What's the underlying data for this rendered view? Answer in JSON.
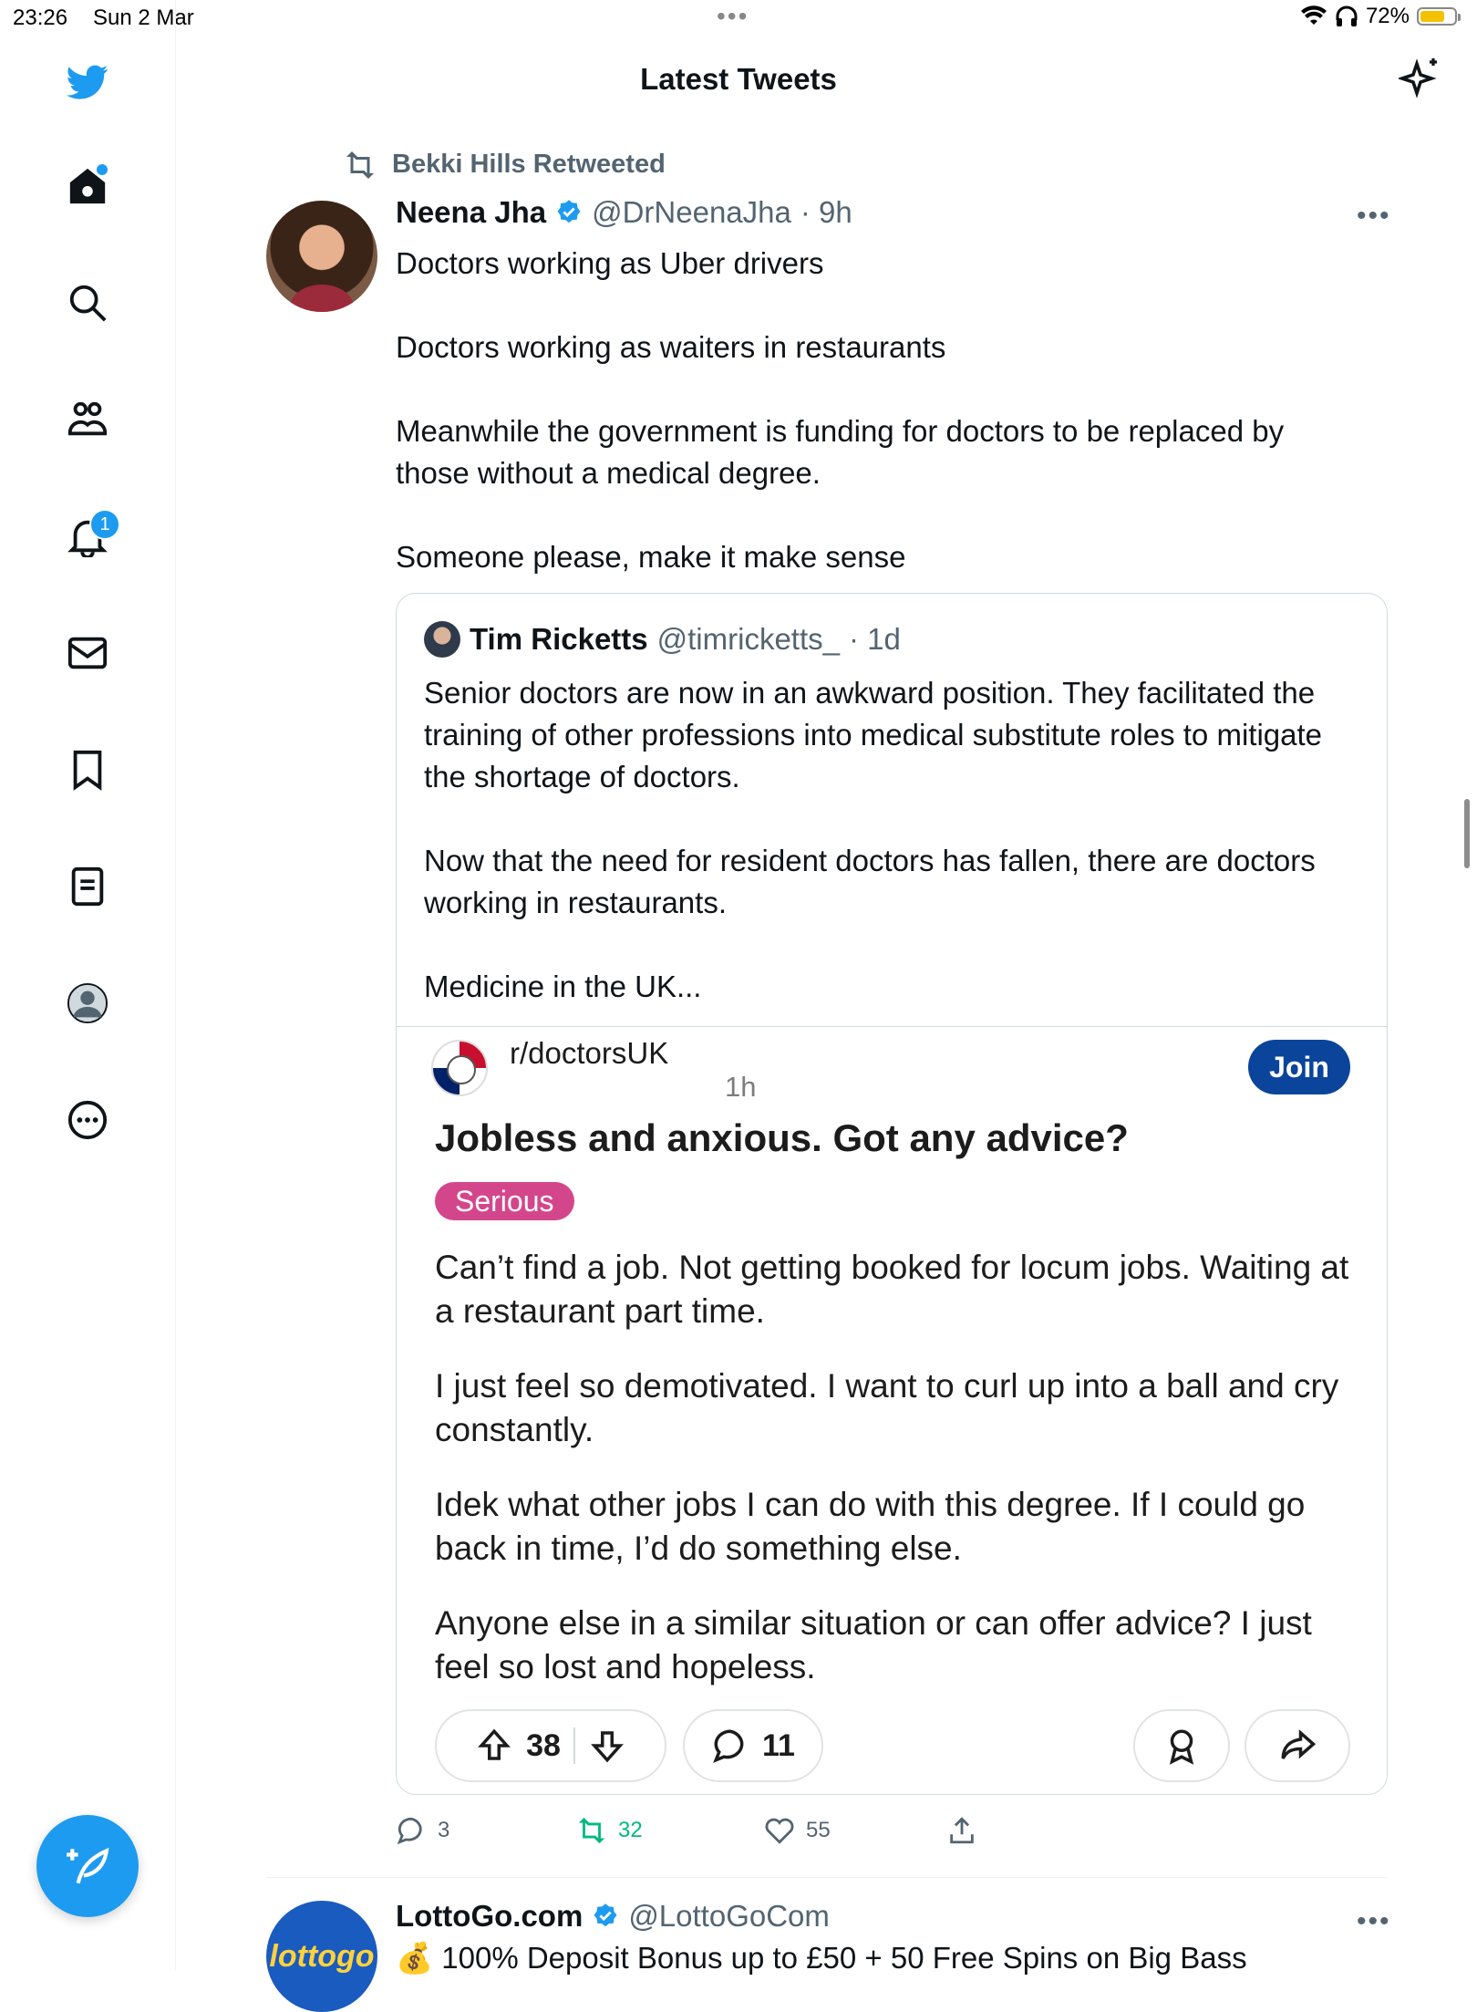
{
  "status_bar": {
    "time": "23:26",
    "date": "Sun 2 Mar",
    "battery": "72%"
  },
  "header": {
    "title": "Latest Tweets"
  },
  "sidebar": {
    "notification_count": "1"
  },
  "tweet": {
    "retweeted_by": "Bekki Hills Retweeted",
    "author_name": "Neena Jha",
    "handle": "@DrNeenaJha",
    "time": "· 9h",
    "paragraphs": [
      "Doctors working as Uber drivers",
      "Doctors working as waiters in restaurants",
      "Meanwhile the government is funding for doctors to be replaced by those without a medical degree.",
      "Someone please, make it make sense"
    ],
    "quote": {
      "author_name": "Tim Ricketts",
      "handle": "@timricketts_",
      "time": "· 1d",
      "paragraphs": [
        "Senior doctors are now in an awkward position. They facilitated the training of other professions into medical substitute roles to mitigate the shortage of doctors.",
        "Now that the need for resident doctors has fallen, there are doctors working in restaurants.",
        "Medicine in the UK..."
      ],
      "reddit": {
        "subreddit": "r/doctorsUK",
        "time": "1h",
        "join_label": "Join",
        "title": "Jobless and anxious. Got any advice?",
        "flair": "Serious",
        "body": [
          "Can’t find a job. Not getting booked for locum jobs. Waiting at a restaurant part time.",
          "I just feel so demotivated. I want to curl up into a ball and cry constantly.",
          "Idek what other jobs I can do with this degree. If I could go back in time, I’d do something else.",
          "Anyone else in a similar situation or can offer advice? I just feel so lost and hopeless."
        ],
        "upvotes": "38",
        "comments": "11"
      }
    },
    "stats": {
      "replies": "3",
      "retweets": "32",
      "likes": "55"
    }
  },
  "tweet2": {
    "author_name": "LottoGo.com",
    "handle": "@LottoGoCom",
    "avatar_text": "lottogo",
    "text": "💰 100% Deposit Bonus up to £50 + 50 Free Spins on Big Bass"
  }
}
